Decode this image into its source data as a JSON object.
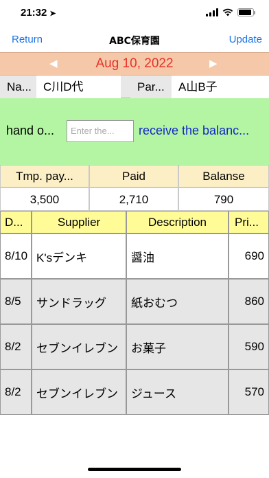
{
  "status": {
    "time": "21:32",
    "location_icon": "location-arrow-icon"
  },
  "nav": {
    "left": "Return",
    "title": "ABC保育園",
    "right": "Update"
  },
  "date": {
    "value": "Aug 10, 2022",
    "prev": "◀",
    "next": "▶"
  },
  "person": {
    "name_label": "Na...",
    "name_value": "C川D代",
    "parent_label": "Par...",
    "parent_value": "A山B子"
  },
  "hand": {
    "label": "hand o...",
    "placeholder": "Enter the...",
    "link": "receive the balanc..."
  },
  "summary": {
    "headers": [
      "Tmp. pay...",
      "Paid",
      "Balanse"
    ],
    "values": [
      "3,500",
      "2,710",
      "790"
    ]
  },
  "table": {
    "headers": [
      "D...",
      "Supplier",
      "Description",
      "Pri..."
    ],
    "rows": [
      {
        "date": "8/10",
        "supplier": "K'sデンキ",
        "description": "醤油",
        "price": "690",
        "bg": "#ffffff"
      },
      {
        "date": "8/5",
        "supplier": "サンドラッグ",
        "description": "紙おむつ",
        "price": "860",
        "bg": "#e6e6e6"
      },
      {
        "date": "8/2",
        "supplier": "セブンイレブン",
        "description": "お菓子",
        "price": "590",
        "bg": "#e6e6e6"
      },
      {
        "date": "8/2",
        "supplier": "セブンイレブン",
        "description": "ジュース",
        "price": "570",
        "bg": "#e6e6e6"
      }
    ]
  },
  "colors": {
    "accent": "#1a73e8",
    "date_text": "#e8332a",
    "date_bg": "#f4c8a8",
    "hand_bg": "#b4f5a4",
    "summary_header_bg": "#fcefc6",
    "table_header_bg": "#fffc98"
  }
}
